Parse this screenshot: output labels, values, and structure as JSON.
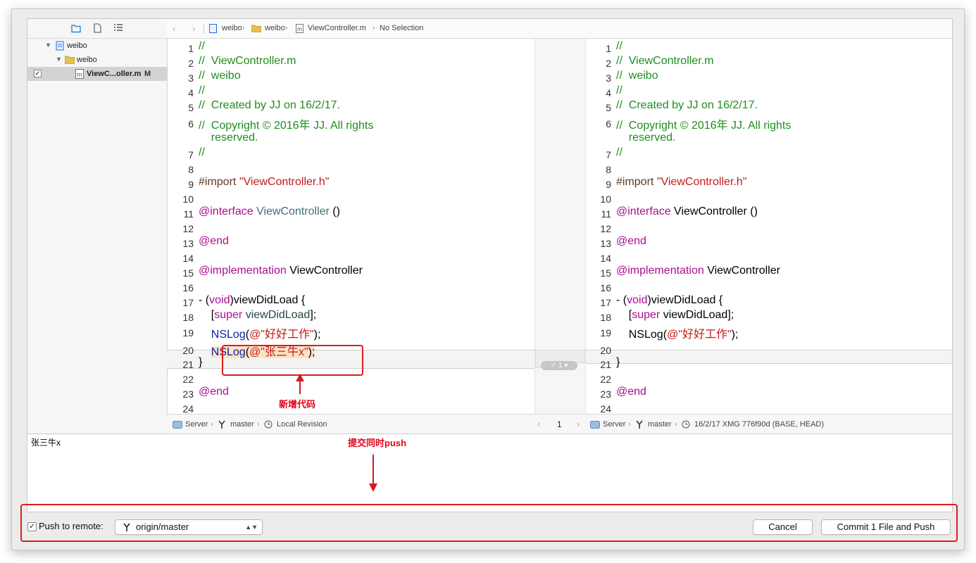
{
  "navigator": {
    "items": [
      {
        "label": "weibo",
        "icon": "project-file-icon"
      },
      {
        "label": "weibo",
        "icon": "folder-icon"
      },
      {
        "label": "ViewC...oller.m",
        "badge": "M",
        "icon": "objc-m-file-icon"
      }
    ]
  },
  "jumpbar": {
    "crumbs": [
      "weibo",
      "weibo",
      "ViewController.m",
      "No Selection"
    ]
  },
  "left_pane": {
    "lines": [
      {
        "n": "1",
        "html": "<span class='cm'>//</span>"
      },
      {
        "n": "2",
        "html": "<span class='cm'>//  ViewController.m</span>"
      },
      {
        "n": "3",
        "html": "<span class='cm'>//  weibo</span>"
      },
      {
        "n": "4",
        "html": "<span class='cm'>//</span>"
      },
      {
        "n": "5",
        "html": "<span class='cm'>//  Created by JJ on 16/2/17.</span>"
      },
      {
        "n": "6",
        "html": "<span class='cm'>//  Copyright © 2016年 JJ. All rights</span>"
      },
      {
        "n": "",
        "html": "<span class='cm'>    reserved.</span>"
      },
      {
        "n": "7",
        "html": "<span class='cm'>//</span>"
      },
      {
        "n": "8",
        "html": ""
      },
      {
        "n": "9",
        "html": "<span class='mc'>#import</span> <span class='str'>\"ViewController.h\"</span>"
      },
      {
        "n": "10",
        "html": ""
      },
      {
        "n": "11",
        "html": "<span class='kw'>@interface</span> <span class='ty'>ViewController</span> ()"
      },
      {
        "n": "12",
        "html": ""
      },
      {
        "n": "13",
        "html": "<span class='kw'>@end</span>"
      },
      {
        "n": "14",
        "html": ""
      },
      {
        "n": "15",
        "html": "<span class='kw'>@implementation</span> ViewController"
      },
      {
        "n": "16",
        "html": ""
      },
      {
        "n": "17",
        "html": "- (<span class='kw'>void</span>)viewDidLoad {"
      },
      {
        "n": "18",
        "html": "    [<span class='kw'>super</span> <span class='fn'>viewDidLoad</span>];"
      },
      {
        "n": "19",
        "html": "    <span class='vs'>NSLog</span>(<span class='str'>@\"好好工作\"</span>);"
      },
      {
        "n": "20",
        "html": "    <span class='vs'>NSLog</span>(<span class='str'>@\"张三牛x\"</span>);"
      },
      {
        "n": "21",
        "html": "}"
      },
      {
        "n": "22",
        "html": ""
      },
      {
        "n": "23",
        "html": "<span class='kw'>@end</span>"
      },
      {
        "n": "24",
        "html": ""
      }
    ]
  },
  "right_pane": {
    "lines": [
      {
        "n": "1",
        "html": "<span class='cm'>//</span>"
      },
      {
        "n": "2",
        "html": "<span class='cm'>//  ViewController.m</span>"
      },
      {
        "n": "3",
        "html": "<span class='cm'>//  weibo</span>"
      },
      {
        "n": "4",
        "html": "<span class='cm'>//</span>"
      },
      {
        "n": "5",
        "html": "<span class='cm'>//  Created by JJ on 16/2/17.</span>"
      },
      {
        "n": "6",
        "html": "<span class='cm'>//  Copyright © 2016年 JJ. All rights</span>"
      },
      {
        "n": "",
        "html": "<span class='cm'>    reserved.</span>"
      },
      {
        "n": "7",
        "html": "<span class='cm'>//</span>"
      },
      {
        "n": "8",
        "html": ""
      },
      {
        "n": "9",
        "html": "<span class='mc'>#import</span> <span class='str'>\"ViewController.h\"</span>"
      },
      {
        "n": "10",
        "html": ""
      },
      {
        "n": "11",
        "html": "<span class='kw'>@interface</span> ViewController ()"
      },
      {
        "n": "12",
        "html": ""
      },
      {
        "n": "13",
        "html": "<span class='kw'>@end</span>"
      },
      {
        "n": "14",
        "html": ""
      },
      {
        "n": "15",
        "html": "<span class='kw'>@implementation</span> ViewController"
      },
      {
        "n": "16",
        "html": ""
      },
      {
        "n": "17",
        "html": "- (<span class='kw'>void</span>)viewDidLoad {"
      },
      {
        "n": "18",
        "html": "    [<span class='kw'>super</span> viewDidLoad];"
      },
      {
        "n": "19",
        "html": "    NSLog(<span class='str'>@\"好好工作\"</span>);"
      },
      {
        "n": "20",
        "html": ""
      },
      {
        "n": "21",
        "html": "}"
      },
      {
        "n": "22",
        "html": ""
      },
      {
        "n": "23",
        "html": "<span class='kw'>@end</span>"
      },
      {
        "n": "24",
        "html": ""
      }
    ]
  },
  "diff_gutter": {
    "change_count": "1"
  },
  "left_bar": {
    "server": "Server",
    "branch": "master",
    "revision": "Local Revision"
  },
  "center_bar": {
    "page": "1"
  },
  "right_bar": {
    "server": "Server",
    "branch": "master",
    "revision": "16/2/17  XMG  776f90d (BASE, HEAD)"
  },
  "commit": {
    "message": "张三牛x"
  },
  "annotations": {
    "new_code": "新增代码",
    "commit_push": "提交同时push"
  },
  "footer": {
    "push_label": "Push to remote:",
    "push_checked": true,
    "remote": "origin/master",
    "cancel_label": "Cancel",
    "commit_label": "Commit 1 File and Push"
  },
  "colors": {
    "annotation": "#e2001a",
    "accent": "#1c6fd6"
  }
}
